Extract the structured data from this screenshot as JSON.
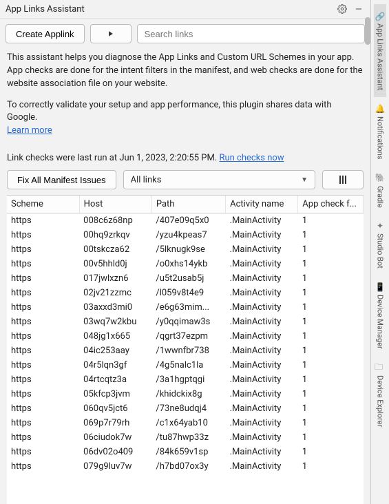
{
  "window": {
    "title": "App Links Assistant"
  },
  "toolbar": {
    "create_label": "Create Applink",
    "search_placeholder": "Search links"
  },
  "description": {
    "p1": "This assistant helps you diagnose the App Links and Custom URL Schemes in your app. App checks are done for the intent filters in the manifest, and web checks are done for the website association file on your website.",
    "p2": "To correctly validate your setup and app performance, this plugin shares data with Google.",
    "learn_more": "Learn more"
  },
  "status": {
    "prefix": "Link checks were last run at Jun 1, 2023, 2:20:55 PM.  ",
    "run_now": "Run checks now"
  },
  "controls": {
    "fix_label": "Fix All Manifest Issues",
    "filter_label": "All links"
  },
  "table": {
    "headers": {
      "scheme": "Scheme",
      "host": "Host",
      "path": "Path",
      "activity": "Activity name",
      "check": "App check f..."
    },
    "rows": [
      {
        "scheme": "https",
        "host": "008c6z68np",
        "path": "/407e09q5x0",
        "activity": ".MainActivity",
        "check": "1"
      },
      {
        "scheme": "https",
        "host": "00hq9zrkqv",
        "path": "/yzu4kpeas7",
        "activity": ".MainActivity",
        "check": "1"
      },
      {
        "scheme": "https",
        "host": "00tskcza62",
        "path": "/5lknugk9se",
        "activity": ".MainActivity",
        "check": "1"
      },
      {
        "scheme": "https",
        "host": "00v5hhld0j",
        "path": "/o0xhs14ykb",
        "activity": ".MainActivity",
        "check": "1"
      },
      {
        "scheme": "https",
        "host": "017jwlxzn6",
        "path": "/u5t2usab5j",
        "activity": ".MainActivity",
        "check": "1"
      },
      {
        "scheme": "https",
        "host": "02jv21zzmc",
        "path": "/l059v8t4e9",
        "activity": ".MainActivity",
        "check": "1"
      },
      {
        "scheme": "https",
        "host": "03axxd3mi0",
        "path": "/e6g63mim...",
        "activity": ".MainActivity",
        "check": "1"
      },
      {
        "scheme": "https",
        "host": "03wq7w2kbu",
        "path": "/y0qqimaw3s",
        "activity": ".MainActivity",
        "check": "1"
      },
      {
        "scheme": "https",
        "host": "048jg1x665",
        "path": "/qgrt37ezpm",
        "activity": ".MainActivity",
        "check": "1"
      },
      {
        "scheme": "https",
        "host": "04ic253aay",
        "path": "/1wwnfbr738",
        "activity": ".MainActivity",
        "check": "1"
      },
      {
        "scheme": "https",
        "host": "04r5lqn3gf",
        "path": "/4g5nalc1la",
        "activity": ".MainActivity",
        "check": "1"
      },
      {
        "scheme": "https",
        "host": "04rtcqtz3a",
        "path": "/3a1hgptqgi",
        "activity": ".MainActivity",
        "check": "1"
      },
      {
        "scheme": "https",
        "host": "05kfcp3jvm",
        "path": "/khidckix8g",
        "activity": ".MainActivity",
        "check": "1"
      },
      {
        "scheme": "https",
        "host": "060qv5jct6",
        "path": "/73ne8udqj4",
        "activity": ".MainActivity",
        "check": "1"
      },
      {
        "scheme": "https",
        "host": "069p7r79rh",
        "path": "/c1x64yab10",
        "activity": ".MainActivity",
        "check": "1"
      },
      {
        "scheme": "https",
        "host": "06ciudok7w",
        "path": "/tu87hwp33z",
        "activity": ".MainActivity",
        "check": "1"
      },
      {
        "scheme": "https",
        "host": "06dv02o409",
        "path": "/84k659v1sp",
        "activity": ".MainActivity",
        "check": "1"
      },
      {
        "scheme": "https",
        "host": "079g9luv7w",
        "path": "/h7bd07ox3y",
        "activity": ".MainActivity",
        "check": "1"
      }
    ]
  },
  "sidebar": {
    "items": [
      {
        "label": "App Links Assistant"
      },
      {
        "label": "Notifications"
      },
      {
        "label": "Gradle"
      },
      {
        "label": "Studio Bot"
      },
      {
        "label": "Device Manager"
      },
      {
        "label": "Device Explorer"
      }
    ]
  }
}
